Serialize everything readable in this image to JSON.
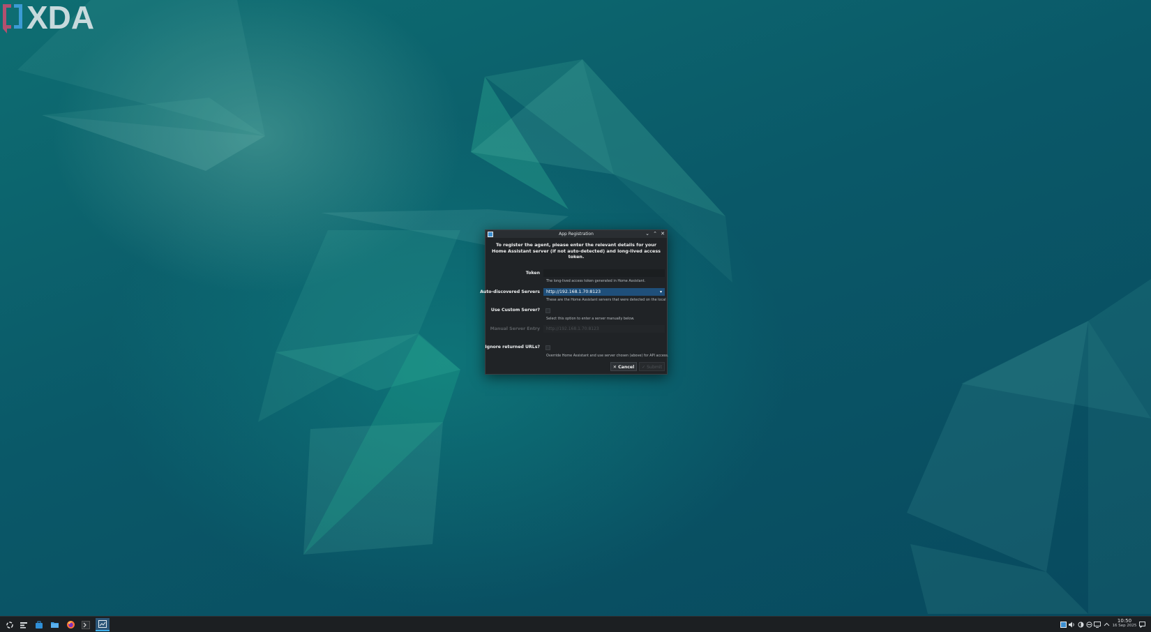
{
  "window": {
    "title": "App Registration",
    "icon": "app-registration-icon"
  },
  "dialog": {
    "intro": "To register the agent, please enter the relevant details for your Home Assistant server (if not auto-detected) and long-lived access token.",
    "token": {
      "label": "Token",
      "value": "",
      "help": "The long-lived access token generated in Home Assistant."
    },
    "servers": {
      "label": "Auto-discovered Servers",
      "selected": "http://192.168.1.70:8123",
      "help": "These are the Home Assistant servers that were detected on the local network."
    },
    "custom_server": {
      "label": "Use Custom Server?",
      "checked": false,
      "help": "Select this option to enter a server manually below."
    },
    "manual_entry": {
      "label": "Manual Server Entry",
      "placeholder": "http://192.168.1.70:8123"
    },
    "ignore_urls": {
      "label": "Ignore returned URLs?",
      "checked": false,
      "help": "Override Home Assistant and use server chosen (above) for API access."
    },
    "buttons": {
      "cancel": "Cancel",
      "submit": "Submit"
    }
  },
  "taskbar": {
    "apps": [
      "application-launcher-icon",
      "overview-icon",
      "store-icon",
      "file-manager-icon",
      "firefox-icon",
      "terminal-icon",
      "app-registration-icon"
    ],
    "clock": {
      "time": "10:50",
      "date": "16 Sep 2025"
    }
  },
  "watermark": "XDA",
  "colors": {
    "accent": "#3daee9",
    "selection": "#1f4f7a",
    "dialog_bg": "#202326",
    "taskbar_bg": "#1c1f22"
  }
}
